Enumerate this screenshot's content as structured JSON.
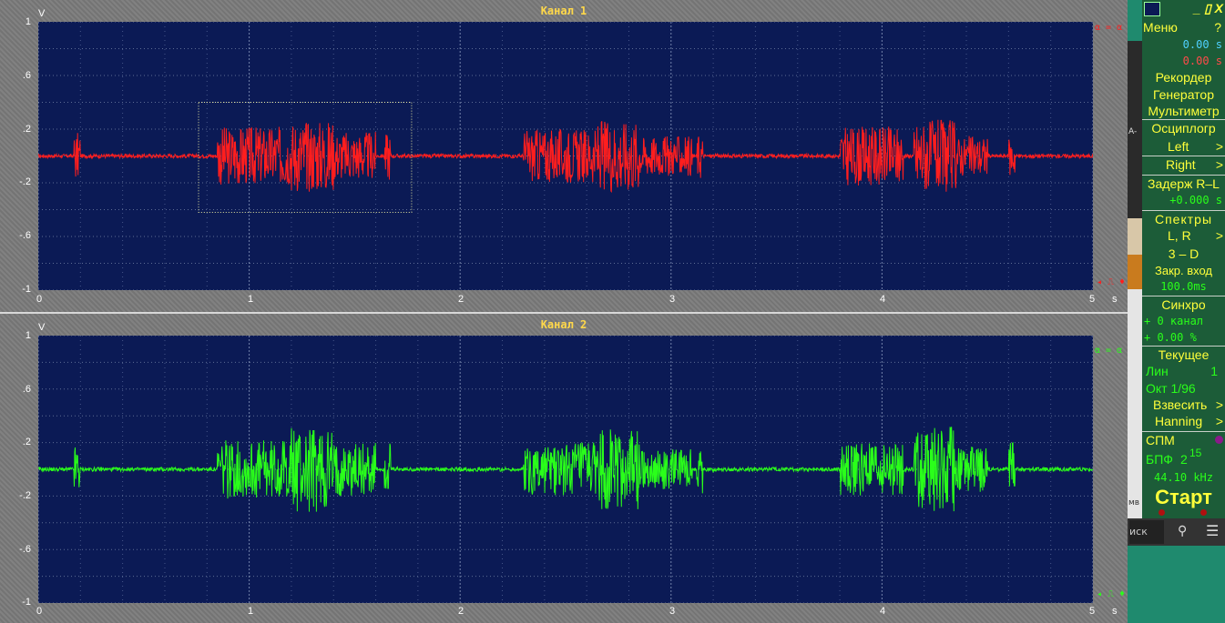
{
  "channels": [
    {
      "title": "Канал 1",
      "color": "#ff1e1e",
      "marker_top": "α = α",
      "marker_bottom": "◂ ⎍ ♦"
    },
    {
      "title": "Канал 2",
      "color": "#2aff1a",
      "marker_top": "α = α",
      "marker_bottom": "◂ ⎍ ♦"
    }
  ],
  "axes": {
    "y_unit": "V",
    "y_ticks": [
      "1",
      ".6",
      ".2",
      "-.2",
      "-.6",
      "-1"
    ],
    "x_unit": "s",
    "x_ticks": [
      "0",
      "1",
      "2",
      "3",
      "4",
      "5"
    ]
  },
  "chart_data": [
    {
      "type": "line",
      "title": "Канал 1",
      "xlabel": "s",
      "ylabel": "V",
      "xlim": [
        0,
        5
      ],
      "ylim": [
        -1,
        1
      ],
      "grid": true,
      "bursts": [
        {
          "start": 0.17,
          "end": 0.2,
          "amp": 0.18
        },
        {
          "start": 0.85,
          "end": 1.2,
          "amp": 0.22
        },
        {
          "start": 1.2,
          "end": 1.4,
          "amp": 0.27
        },
        {
          "start": 1.4,
          "end": 1.6,
          "amp": 0.18
        },
        {
          "start": 1.64,
          "end": 1.67,
          "amp": 0.18
        },
        {
          "start": 2.3,
          "end": 2.65,
          "amp": 0.2
        },
        {
          "start": 2.65,
          "end": 2.85,
          "amp": 0.27
        },
        {
          "start": 2.85,
          "end": 3.1,
          "amp": 0.15
        },
        {
          "start": 3.12,
          "end": 3.15,
          "amp": 0.17
        },
        {
          "start": 3.8,
          "end": 4.1,
          "amp": 0.22
        },
        {
          "start": 4.15,
          "end": 4.35,
          "amp": 0.27
        },
        {
          "start": 4.35,
          "end": 4.5,
          "amp": 0.15
        },
        {
          "start": 4.6,
          "end": 4.63,
          "amp": 0.15
        }
      ],
      "selection_box": {
        "x": [
          0.76,
          1.77
        ],
        "y": [
          -0.42,
          0.4
        ]
      }
    },
    {
      "type": "line",
      "title": "Канал 2",
      "xlabel": "s",
      "ylabel": "V",
      "xlim": [
        0,
        5
      ],
      "ylim": [
        -1,
        1
      ],
      "grid": true,
      "bursts": [
        {
          "start": 0.17,
          "end": 0.2,
          "amp": 0.18
        },
        {
          "start": 0.85,
          "end": 1.2,
          "amp": 0.22
        },
        {
          "start": 1.2,
          "end": 1.4,
          "amp": 0.33
        },
        {
          "start": 1.4,
          "end": 1.6,
          "amp": 0.2
        },
        {
          "start": 1.64,
          "end": 1.67,
          "amp": 0.2
        },
        {
          "start": 2.3,
          "end": 2.65,
          "amp": 0.2
        },
        {
          "start": 2.65,
          "end": 2.85,
          "amp": 0.3
        },
        {
          "start": 2.85,
          "end": 3.1,
          "amp": 0.15
        },
        {
          "start": 3.12,
          "end": 3.15,
          "amp": 0.2
        },
        {
          "start": 3.8,
          "end": 4.1,
          "amp": 0.2
        },
        {
          "start": 4.15,
          "end": 4.35,
          "amp": 0.32
        },
        {
          "start": 4.35,
          "end": 4.5,
          "amp": 0.17
        },
        {
          "start": 4.6,
          "end": 4.63,
          "amp": 0.2
        }
      ]
    }
  ],
  "menu": {
    "window_buttons": "_ ▯ X",
    "menu_label": "Меню",
    "help": "?",
    "time1": "0.00 s",
    "time2": "0.00 s",
    "recorder": "Рекордер",
    "generator": "Генератор",
    "multimeter": "Мультиметр",
    "oscilloscope": "Осциплогр",
    "left": "Left",
    "right": "Right",
    "delay_label": "Задерж R–L",
    "delay_value": "+0.000 s",
    "spectra": "Спектры",
    "lr": "L, R",
    "threed": "3 – D",
    "closed_input": "Закр. вход",
    "closed_value": "100.0ms",
    "sync": "Синхро",
    "sync_ch": "+ 0 канал",
    "sync_pct": "+ 0.00 %",
    "current": "Текущее",
    "lin": "Лин",
    "lin_val": "1",
    "oct": "Окт 1/96",
    "weigh": "Взвесить",
    "hanning": "Hanning",
    "spm": "СПМ",
    "fft": "БПФ",
    "fft_base": "2",
    "fft_exp": "15",
    "rate": "44.10 kHz",
    "start": "Старт"
  },
  "side": {
    "a_label": "A-",
    "mv_label": "мв"
  },
  "taskbar": {
    "search_text": "иск"
  }
}
